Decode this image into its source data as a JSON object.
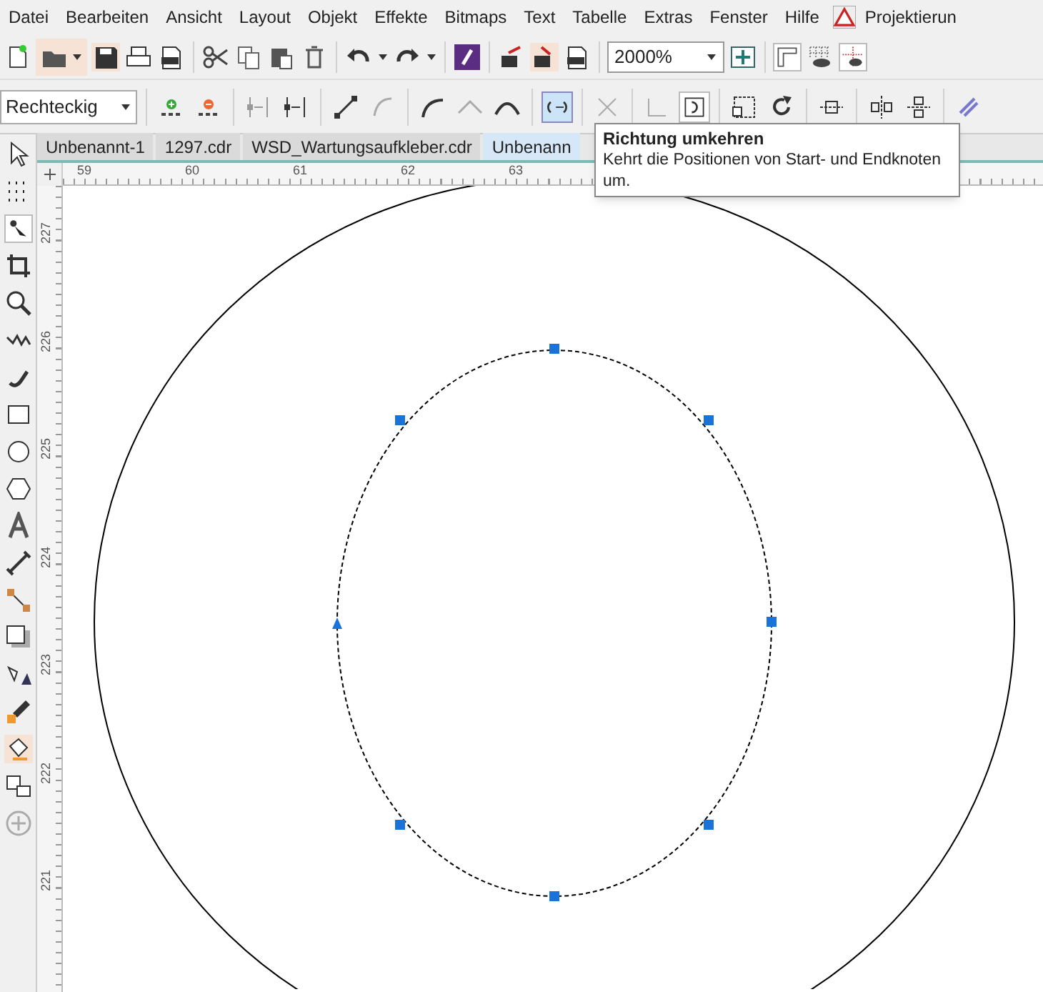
{
  "menu_bar": {
    "items": [
      "Datei",
      "Bearbeiten",
      "Ansicht",
      "Layout",
      "Objekt",
      "Effekte",
      "Bitmaps",
      "Text",
      "Tabelle",
      "Extras",
      "Fenster",
      "Hilfe"
    ],
    "project_item": "Projektierun"
  },
  "toolbar": {
    "zoom": "2000%"
  },
  "property_bar": {
    "node_type": "Rechteckig"
  },
  "document_tabs": [
    {
      "label": "Unbenannt-1",
      "selected": false
    },
    {
      "label": "1297.cdr",
      "selected": false
    },
    {
      "label": "WSD_Wartungsaufkleber.cdr",
      "selected": false
    },
    {
      "label": "Unbenann",
      "selected": true
    }
  ],
  "horizontal_ruler": [
    "59",
    "60",
    "61",
    "62",
    "63"
  ],
  "vertical_ruler": [
    "227",
    "226",
    "225",
    "224",
    "223",
    "222",
    "221"
  ],
  "tooltip": {
    "title": "Richtung umkehren",
    "description": "Kehrt die Positionen von Start- und Endknoten um."
  }
}
